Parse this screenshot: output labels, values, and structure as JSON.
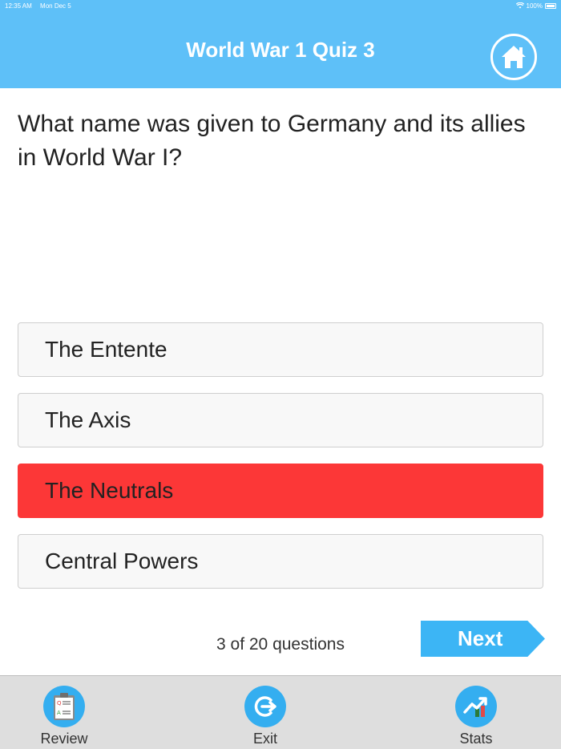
{
  "status_bar": {
    "time": "12:35 AM",
    "date": "Mon Dec 5",
    "battery": "100%"
  },
  "header": {
    "title": "World War 1 Quiz 3",
    "home_icon": "home-icon"
  },
  "question": {
    "text": "What name was given to Germany and its allies in World War I?"
  },
  "answers": [
    {
      "label": "The Entente",
      "state": "normal"
    },
    {
      "label": "The Axis",
      "state": "normal"
    },
    {
      "label": "The Neutrals",
      "state": "wrong"
    },
    {
      "label": "Central Powers",
      "state": "normal"
    }
  ],
  "progress": {
    "text": "3 of 20 questions",
    "current": 3,
    "total": 20
  },
  "next_button": {
    "label": "Next"
  },
  "tab_bar": {
    "items": [
      {
        "label": "Review",
        "icon": "clipboard-qa-icon"
      },
      {
        "label": "Exit",
        "icon": "exit-icon"
      },
      {
        "label": "Stats",
        "icon": "stats-chart-icon"
      }
    ]
  },
  "colors": {
    "header": "#5ec0f8",
    "wrong_answer": "#fc3737",
    "next_button": "#3cb5f5",
    "tab_icon": "#34aef0",
    "tab_bar": "#dedede"
  }
}
